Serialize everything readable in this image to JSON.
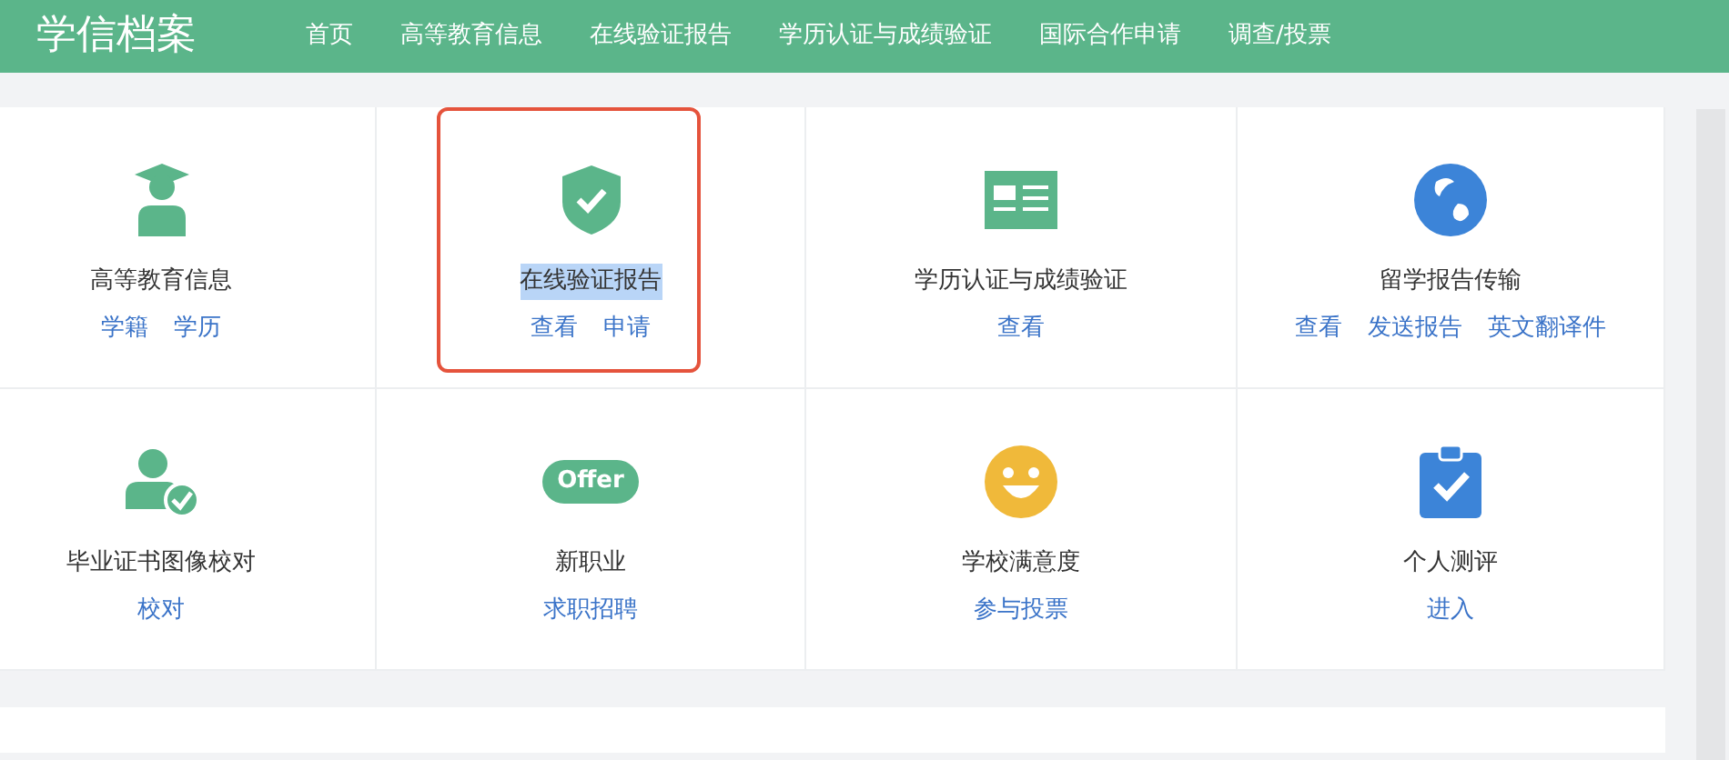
{
  "header": {
    "logo": "学信档案",
    "nav": [
      "首页",
      "高等教育信息",
      "在线验证报告",
      "学历认证与成绩验证",
      "国际合作申请",
      "调查/投票"
    ]
  },
  "services": [
    {
      "title": "高等教育信息",
      "highlighted": false,
      "links": [
        "学籍",
        "学历"
      ]
    },
    {
      "title": "在线验证报告",
      "highlighted": true,
      "links": [
        "查看",
        "申请"
      ]
    },
    {
      "title": "学历认证与成绩验证",
      "highlighted": false,
      "links": [
        "查看"
      ]
    },
    {
      "title": "留学报告传输",
      "highlighted": false,
      "links": [
        "查看",
        "发送报告",
        "英文翻译件"
      ]
    },
    {
      "title": "毕业证书图像校对",
      "highlighted": false,
      "links": [
        "校对"
      ]
    },
    {
      "badge": "Offer",
      "title": "新职业",
      "highlighted": false,
      "links": [
        "求职招聘"
      ]
    },
    {
      "title": "学校满意度",
      "highlighted": false,
      "links": [
        "参与投票"
      ]
    },
    {
      "title": "个人测评",
      "highlighted": false,
      "links": [
        "进入"
      ]
    }
  ]
}
